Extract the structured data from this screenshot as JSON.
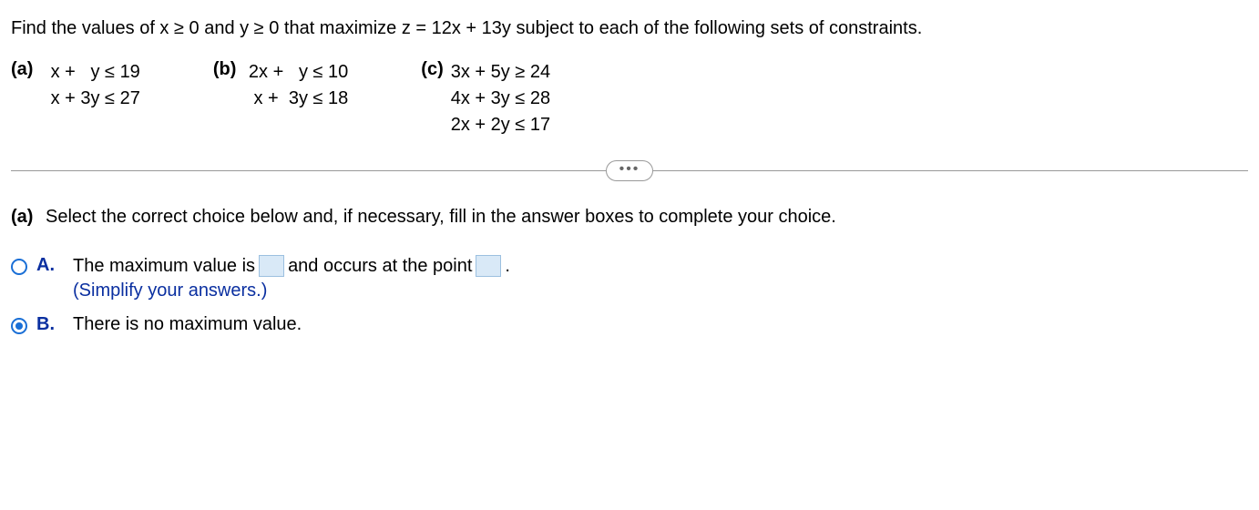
{
  "prompt": "Find the values of x ≥ 0 and y ≥ 0 that maximize z = 12x + 13y subject to each of the following sets of constraints.",
  "parts": {
    "a": {
      "label": "(a)",
      "lines": [
        "  x +   y ≤ 19",
        "  x + 3y ≤ 27"
      ]
    },
    "b": {
      "label": "(b)",
      "lines": [
        " 2x +   y ≤ 10",
        "  x +  3y ≤ 18"
      ]
    },
    "c": {
      "label": "(c)",
      "lines": [
        "3x + 5y ≥ 24",
        "4x + 3y ≤ 28",
        "2x + 2y ≤ 17"
      ]
    }
  },
  "divider_dots": "•••",
  "question": {
    "label": "(a)",
    "text": " Select the correct choice below and, if necessary, fill in the answer boxes to complete your choice."
  },
  "choices": {
    "A": {
      "letter": "A.",
      "text_before": "The maximum value is ",
      "text_mid": " and occurs at the point ",
      "text_after": ".",
      "hint": "(Simplify your answers.)",
      "selected": false
    },
    "B": {
      "letter": "B.",
      "text": "There is no maximum value.",
      "selected": true
    }
  }
}
